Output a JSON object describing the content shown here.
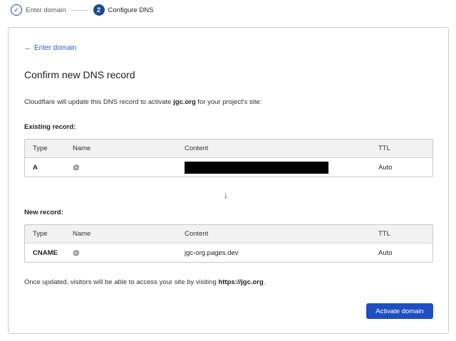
{
  "stepper": {
    "step1_label": "Enter domain",
    "step2_number": "2",
    "step2_label": "Configure DNS",
    "check_glyph": "✓"
  },
  "back_link": {
    "arrow": "←",
    "label": "Enter domain"
  },
  "title": "Confirm new DNS record",
  "description": {
    "prefix": "Cloudflare will update this DNS record to activate ",
    "domain": "jgc.org",
    "suffix": " for your project's site:"
  },
  "existing": {
    "label": "Existing record:",
    "headers": {
      "type": "Type",
      "name": "Name",
      "content": "Content",
      "ttl": "TTL"
    },
    "row": {
      "type": "A",
      "name": "@",
      "content": "",
      "ttl": "Auto"
    }
  },
  "down_arrow": "↓",
  "new_record": {
    "label": "New record:",
    "headers": {
      "type": "Type",
      "name": "Name",
      "content": "Content",
      "ttl": "TTL"
    },
    "row": {
      "type": "CNAME",
      "name": "@",
      "content": "jgc-org.pages.dev",
      "ttl": "Auto"
    }
  },
  "footer": {
    "prefix": "Once updated, visitors will be able to access your site by visiting ",
    "url": "https://jgc.org",
    "suffix": "."
  },
  "activate_button": "Activate domain",
  "colors": {
    "accent": "#1e4fc1",
    "link": "#1e5cc5",
    "step": "#1e4a93"
  }
}
